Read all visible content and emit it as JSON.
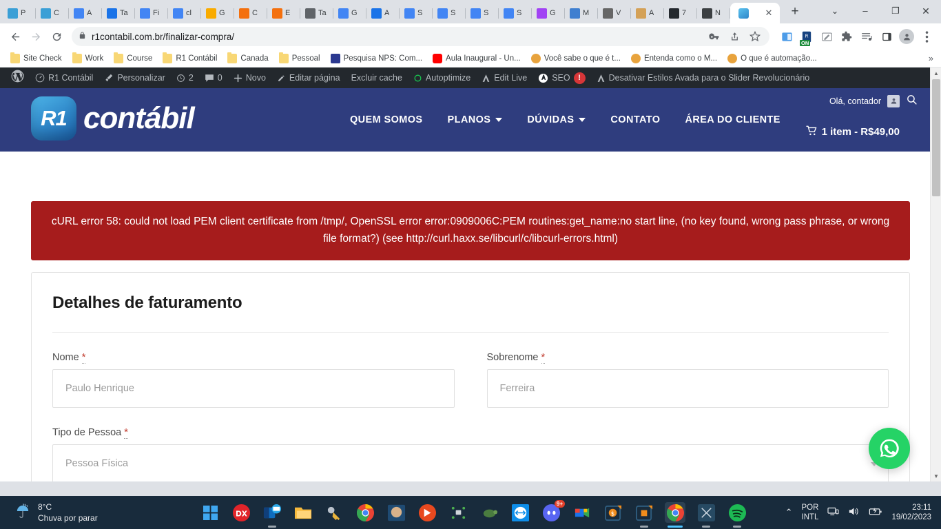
{
  "browser": {
    "tabs": [
      {
        "label": "P",
        "favicon": "r1-contabil-icon",
        "color": "#3a9fd6"
      },
      {
        "label": "C",
        "favicon": "r1-contabil-icon",
        "color": "#3a9fd6"
      },
      {
        "label": "A",
        "favicon": "google-ads-icon",
        "color": "#4285f4"
      },
      {
        "label": "Ta",
        "favicon": "docs-outline-icon",
        "color": "#1a73e8"
      },
      {
        "label": "Fi",
        "favicon": "chat-icon",
        "color": "#4285f4"
      },
      {
        "label": "cl",
        "favicon": "google-icon",
        "color": "#4285f4"
      },
      {
        "label": "G",
        "favicon": "analytics-icon",
        "color": "#f9ab00"
      },
      {
        "label": "C",
        "favicon": "slide-icon",
        "color": "#f4700e"
      },
      {
        "label": "E",
        "favicon": "slide-icon",
        "color": "#f4700e"
      },
      {
        "label": "Ta",
        "favicon": "no-image-icon",
        "color": "#5f6368"
      },
      {
        "label": "G",
        "favicon": "diamond-icon",
        "color": "#4285f4"
      },
      {
        "label": "A",
        "favicon": "app-icon",
        "color": "#1a73e8"
      },
      {
        "label": "S",
        "favicon": "google-icon",
        "color": "#4285f4"
      },
      {
        "label": "S",
        "favicon": "google-icon",
        "color": "#4285f4"
      },
      {
        "label": "S",
        "favicon": "google-icon",
        "color": "#4285f4"
      },
      {
        "label": "S",
        "favicon": "google-icon",
        "color": "#4285f4"
      },
      {
        "label": "G",
        "favicon": "lastpass-icon",
        "color": "#a142f4"
      },
      {
        "label": "M",
        "favicon": "graduation-icon",
        "color": "#3f7fd0"
      },
      {
        "label": "V",
        "favicon": "wordpress-icon",
        "color": "#666666"
      },
      {
        "label": "A",
        "favicon": "avada-icon",
        "color": "#d4a157"
      },
      {
        "label": "7",
        "favicon": "github-icon",
        "color": "#24292e"
      },
      {
        "label": "N",
        "favicon": "ghost-icon",
        "color": "#3c4043"
      }
    ],
    "active_tab": {
      "label": "",
      "favicon": "r1-contabil-icon",
      "close_label": "✕"
    },
    "new_tab_label": "+",
    "window_controls": {
      "list": "⌄",
      "minimize": "–",
      "maximize": "❐",
      "close": "✕"
    },
    "address": {
      "lock_icon": "lock-icon",
      "url": "r1contabil.com.br/finalizar-compra/"
    },
    "omnibox_icons": [
      "key-icon",
      "share-icon",
      "bookmark-star-icon"
    ],
    "toolbar_icons": [
      "reading-list-icon",
      "extension-on-icon",
      "edit-extension-icon",
      "puzzle-icon",
      "media-list-icon",
      "side-panel-icon",
      "profile-avatar-icon",
      "chrome-menu-icon"
    ],
    "extension_badge": "ON",
    "bookmarks": [
      {
        "label": "Site Check",
        "icon": "folder-icon"
      },
      {
        "label": "Work",
        "icon": "folder-icon"
      },
      {
        "label": "Course",
        "icon": "folder-icon"
      },
      {
        "label": "R1 Contábil",
        "icon": "folder-icon"
      },
      {
        "label": "Canada",
        "icon": "folder-icon"
      },
      {
        "label": "Pessoal",
        "icon": "folder-icon"
      },
      {
        "label": "Pesquisa NPS: Com...",
        "icon": "nps-icon"
      },
      {
        "label": "Aula Inaugural - Un...",
        "icon": "youtube-icon"
      },
      {
        "label": "Você sabe o que é t...",
        "icon": "person-icon"
      },
      {
        "label": "Entenda como o M...",
        "icon": "person-icon"
      },
      {
        "label": "O que é automação...",
        "icon": "person-icon"
      }
    ],
    "bookmarks_overflow": "»"
  },
  "wp_admin_bar": {
    "logo_icon": "wordpress-icon",
    "items": [
      {
        "label": "R1 Contábil",
        "icon": "dashboard-icon"
      },
      {
        "label": "Personalizar",
        "icon": "brush-icon"
      },
      {
        "label": "2",
        "icon": "updates-icon"
      },
      {
        "label": "0",
        "icon": "comments-icon"
      },
      {
        "label": "Novo",
        "icon": "plus-icon"
      },
      {
        "label": "Editar página",
        "icon": "pencil-icon"
      },
      {
        "label": "Excluir cache",
        "icon": ""
      },
      {
        "label": "Autoptimize",
        "icon": "circle-icon"
      },
      {
        "label": "Edit Live",
        "icon": "avada-icon"
      },
      {
        "label": "SEO",
        "icon": "yoast-icon",
        "badge": "!"
      },
      {
        "label": "Desativar Estilos Avada para o Slider Revolucionário",
        "icon": "avada-icon"
      }
    ]
  },
  "site_header": {
    "logo": {
      "badge_text": "R1",
      "wordmark": "contábil"
    },
    "nav": [
      {
        "label": "QUEM SOMOS",
        "has_dropdown": false
      },
      {
        "label": "PLANOS",
        "has_dropdown": true
      },
      {
        "label": "DÚVIDAS",
        "has_dropdown": true
      },
      {
        "label": "CONTATO",
        "has_dropdown": false
      },
      {
        "label": "ÁREA DO CLIENTE",
        "has_dropdown": false
      }
    ],
    "greeting": "Olá, contador",
    "avatar_icon": "user-avatar-icon",
    "search_icon": "search-icon",
    "cart": {
      "icon": "cart-icon",
      "label": "1 item - R$49,00"
    },
    "bg_color": "#2f3d7e"
  },
  "error_banner": {
    "color": "#a61c1c",
    "text": "cURL error 58: could not load PEM client certificate from /tmp/, OpenSSL error error:0909006C:PEM routines:get_name:no start line, (no key found, wrong pass phrase, or wrong file format?) (see http://curl.haxx.se/libcurl/c/libcurl-errors.html)"
  },
  "checkout": {
    "heading": "Detalhes de faturamento",
    "required_mark": "*",
    "fields": [
      {
        "label": "Nome",
        "required": true,
        "value": "Paulo Henrique",
        "type": "text"
      },
      {
        "label": "Sobrenome",
        "required": true,
        "value": "Ferreira",
        "type": "text"
      },
      {
        "label": "Tipo de Pessoa",
        "required": true,
        "value": "Pessoa Física",
        "type": "select"
      }
    ]
  },
  "whatsapp_button": {
    "icon": "whatsapp-icon",
    "color": "#25d366"
  },
  "scrollbar": {
    "up_arrow": "▲",
    "down_arrow": "▼"
  },
  "taskbar": {
    "weather": {
      "temp": "8°C",
      "condition": "Chuva por parar",
      "icon": "rain-icon"
    },
    "start_icon": "windows-start-icon",
    "apps": [
      {
        "name": "dx-icon",
        "running": false
      },
      {
        "name": "outlook-icon",
        "running": true
      },
      {
        "name": "file-explorer-icon",
        "running": false
      },
      {
        "name": "keys-icon",
        "running": false
      },
      {
        "name": "chrome-icon",
        "running": false
      },
      {
        "name": "photo-viewer-icon",
        "running": false
      },
      {
        "name": "remote-desktop-icon",
        "running": false
      },
      {
        "name": "network-tool-icon",
        "running": false
      },
      {
        "name": "turtle-icon",
        "running": false
      },
      {
        "name": "teamviewer-icon",
        "running": false
      },
      {
        "name": "discord-icon",
        "running": false,
        "badge": "9+"
      },
      {
        "name": "google-meet-icon",
        "running": false
      },
      {
        "name": "money-app-icon",
        "running": false
      },
      {
        "name": "orange-app-icon",
        "running": true
      },
      {
        "name": "chrome-icon",
        "running": true,
        "selected": true
      },
      {
        "name": "snipping-tool-icon",
        "running": true
      },
      {
        "name": "spotify-icon",
        "running": true
      }
    ],
    "tray": {
      "chevron": "⌃",
      "language_line1": "POR",
      "language_line2": "INTL",
      "icons": [
        "network-icon",
        "volume-icon",
        "battery-icon"
      ],
      "time": "23:11",
      "date": "19/02/2023"
    }
  }
}
